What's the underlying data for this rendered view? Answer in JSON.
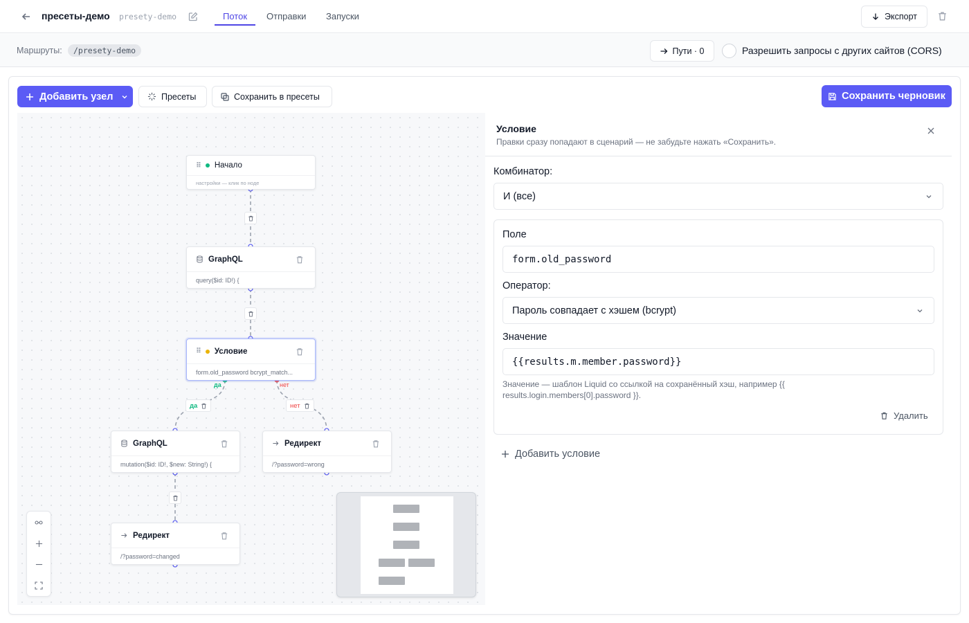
{
  "header": {
    "project_title": "пресеты-демо",
    "project_slug": "presety-demo",
    "tabs": [
      {
        "label": "Поток",
        "active": true
      },
      {
        "label": "Отправки",
        "active": false
      },
      {
        "label": "Запуски",
        "active": false
      }
    ],
    "export_label": "Экспорт"
  },
  "subbar": {
    "routes_label": "Маршруты:",
    "route": "/presety-demo",
    "paths_label": "Пути · 0",
    "cors_label": "Разрешить запросы с других сайтов (CORS)",
    "cors_enabled": false
  },
  "toolbar": {
    "add_node_label": "Добавить узел",
    "presets_label": "Пресеты",
    "save_presets_label": "Сохранить в пресеты",
    "save_draft_label": "Сохранить черновик"
  },
  "flow": {
    "nodes": [
      {
        "id": "start",
        "title": "Начало",
        "body": "настройки — клик по ноде",
        "status_color": "#10b981"
      },
      {
        "id": "gql1",
        "title": "GraphQL",
        "body": "query($id: ID!) {"
      },
      {
        "id": "cond",
        "title": "Условие",
        "body": "form.old_password bcrypt_match...",
        "status_color": "#eab308"
      },
      {
        "id": "gql2",
        "title": "GraphQL",
        "body": "mutation($id: ID!, $new: String!) {"
      },
      {
        "id": "redir1",
        "title": "Редирект",
        "body": "/?password=wrong"
      },
      {
        "id": "redir2",
        "title": "Редирект",
        "body": "/?password=changed"
      }
    ],
    "branch_yes": "да",
    "branch_no": "нет",
    "colors": {
      "yes": "#10b981",
      "no": "#ef4444",
      "handle": "#6366f1"
    }
  },
  "panel": {
    "title": "Условие",
    "subtitle": "Правки сразу попадают в сценарий — не забудьте нажать «Сохранить».",
    "combinator_label": "Комбинатор:",
    "combinator_value": "И (все)",
    "condition": {
      "field_label": "Поле",
      "field_value": "form.old_password",
      "operator_label": "Оператор:",
      "operator_value": "Пароль совпадает с хэшем (bcrypt)",
      "value_label": "Значение",
      "value_value": "{{results.m.member.password}}",
      "hint": "Значение — шаблон Liquid со ссылкой на сохранённый хэш, например {{ results.login.members[0].password }}.",
      "delete_label": "Удалить"
    },
    "add_condition_label": "Добавить условие"
  },
  "theme": {
    "accent": "#5b5bf5"
  }
}
